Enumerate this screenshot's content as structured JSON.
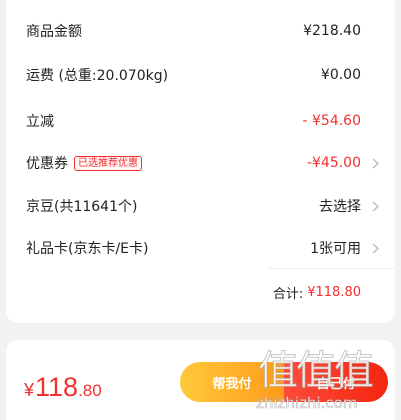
{
  "summary": {
    "rows": [
      {
        "label": "商品金额",
        "value": "¥218.40"
      },
      {
        "label": "运费 (总重:20.070kg)",
        "value": "¥0.00"
      },
      {
        "label": "立减",
        "value": "- ¥54.60"
      },
      {
        "label": "优惠券",
        "tag": "已选推荐优惠",
        "value": "-¥45.00"
      },
      {
        "label": "京豆(共11641个)",
        "value": "去选择"
      },
      {
        "label": "礼品卡(京东卡/E卡)",
        "value": "1张可用"
      }
    ],
    "total_label": "合计:",
    "total_value": "¥118.80"
  },
  "bottom_bar": {
    "currency": "¥",
    "price_int": "118",
    "price_dec": ".80",
    "help_pay_label": "帮我付",
    "self_pay_label": "自己付"
  },
  "watermark": {
    "glyphs": "值值值",
    "url": "zhizhizhi.com"
  },
  "colors": {
    "accent_red": "#f23030",
    "help_button": "#ffb22a",
    "self_button": "#f2260f"
  },
  "icons": [
    "chevron-right-icon"
  ]
}
